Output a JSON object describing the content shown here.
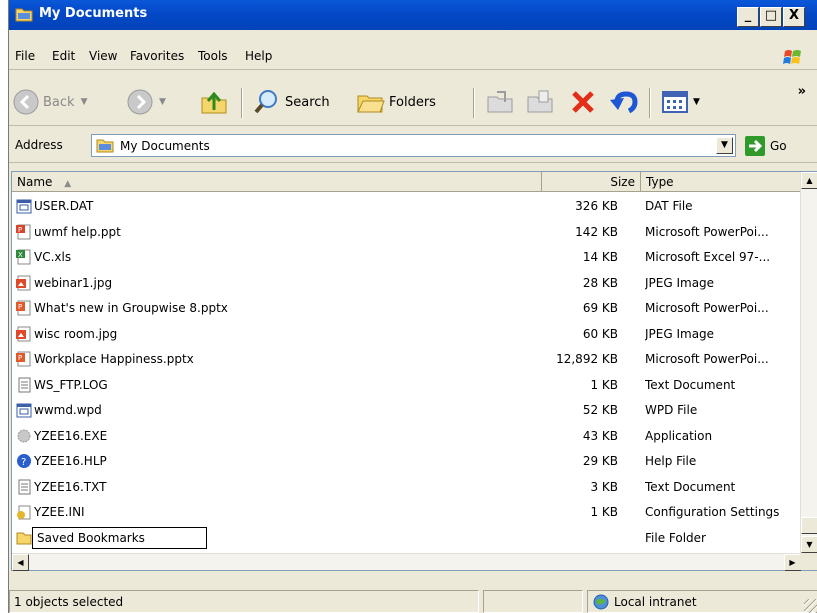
{
  "window": {
    "title": "My Documents",
    "controls": {
      "minimize": "_",
      "maximize": "□",
      "close": "X"
    }
  },
  "menubar": [
    {
      "label": "File"
    },
    {
      "label": "Edit"
    },
    {
      "label": "View"
    },
    {
      "label": "Favorites"
    },
    {
      "label": "Tools"
    },
    {
      "label": "Help"
    }
  ],
  "toolbar": {
    "back_label": "Back",
    "search_label": "Search",
    "folders_label": "Folders",
    "overflow": "»"
  },
  "address": {
    "label": "Address",
    "value": "My Documents",
    "go_label": "Go"
  },
  "columns": {
    "name": "Name",
    "size": "Size",
    "type": "Type"
  },
  "files": [
    {
      "name": "USER.DAT",
      "size": "326 KB",
      "type": "DAT File",
      "icon": "dat-file-icon"
    },
    {
      "name": "uwmf help.ppt",
      "size": "142 KB",
      "type": "Microsoft PowerPoi...",
      "icon": "ppt-file-icon"
    },
    {
      "name": "VC.xls",
      "size": "14 KB",
      "type": "Microsoft Excel 97-...",
      "icon": "xls-file-icon"
    },
    {
      "name": "webinar1.jpg",
      "size": "28 KB",
      "type": "JPEG Image",
      "icon": "jpeg-file-icon"
    },
    {
      "name": "What's new in Groupwise 8.pptx",
      "size": "69 KB",
      "type": "Microsoft PowerPoi...",
      "icon": "pptx-file-icon"
    },
    {
      "name": "wisc room.jpg",
      "size": "60 KB",
      "type": "JPEG Image",
      "icon": "jpeg-file-icon"
    },
    {
      "name": "Workplace Happiness.pptx",
      "size": "12,892 KB",
      "type": "Microsoft PowerPoi...",
      "icon": "pptx-file-icon"
    },
    {
      "name": "WS_FTP.LOG",
      "size": "1 KB",
      "type": "Text Document",
      "icon": "text-file-icon"
    },
    {
      "name": "wwmd.wpd",
      "size": "52 KB",
      "type": "WPD File",
      "icon": "wpd-file-icon"
    },
    {
      "name": "YZEE16.EXE",
      "size": "43 KB",
      "type": "Application",
      "icon": "exe-file-icon"
    },
    {
      "name": "YZEE16.HLP",
      "size": "29 KB",
      "type": "Help File",
      "icon": "help-file-icon"
    },
    {
      "name": "YZEE16.TXT",
      "size": "3 KB",
      "type": "Text Document",
      "icon": "text-file-icon"
    },
    {
      "name": "YZEE.INI",
      "size": "1 KB",
      "type": "Configuration Settings",
      "icon": "ini-file-icon"
    },
    {
      "name": "Saved Bookmarks",
      "size": "",
      "type": "File Folder",
      "icon": "folder-icon",
      "renaming": true
    }
  ],
  "statusbar": {
    "selection": "1 objects selected",
    "zone": "Local intranet"
  }
}
